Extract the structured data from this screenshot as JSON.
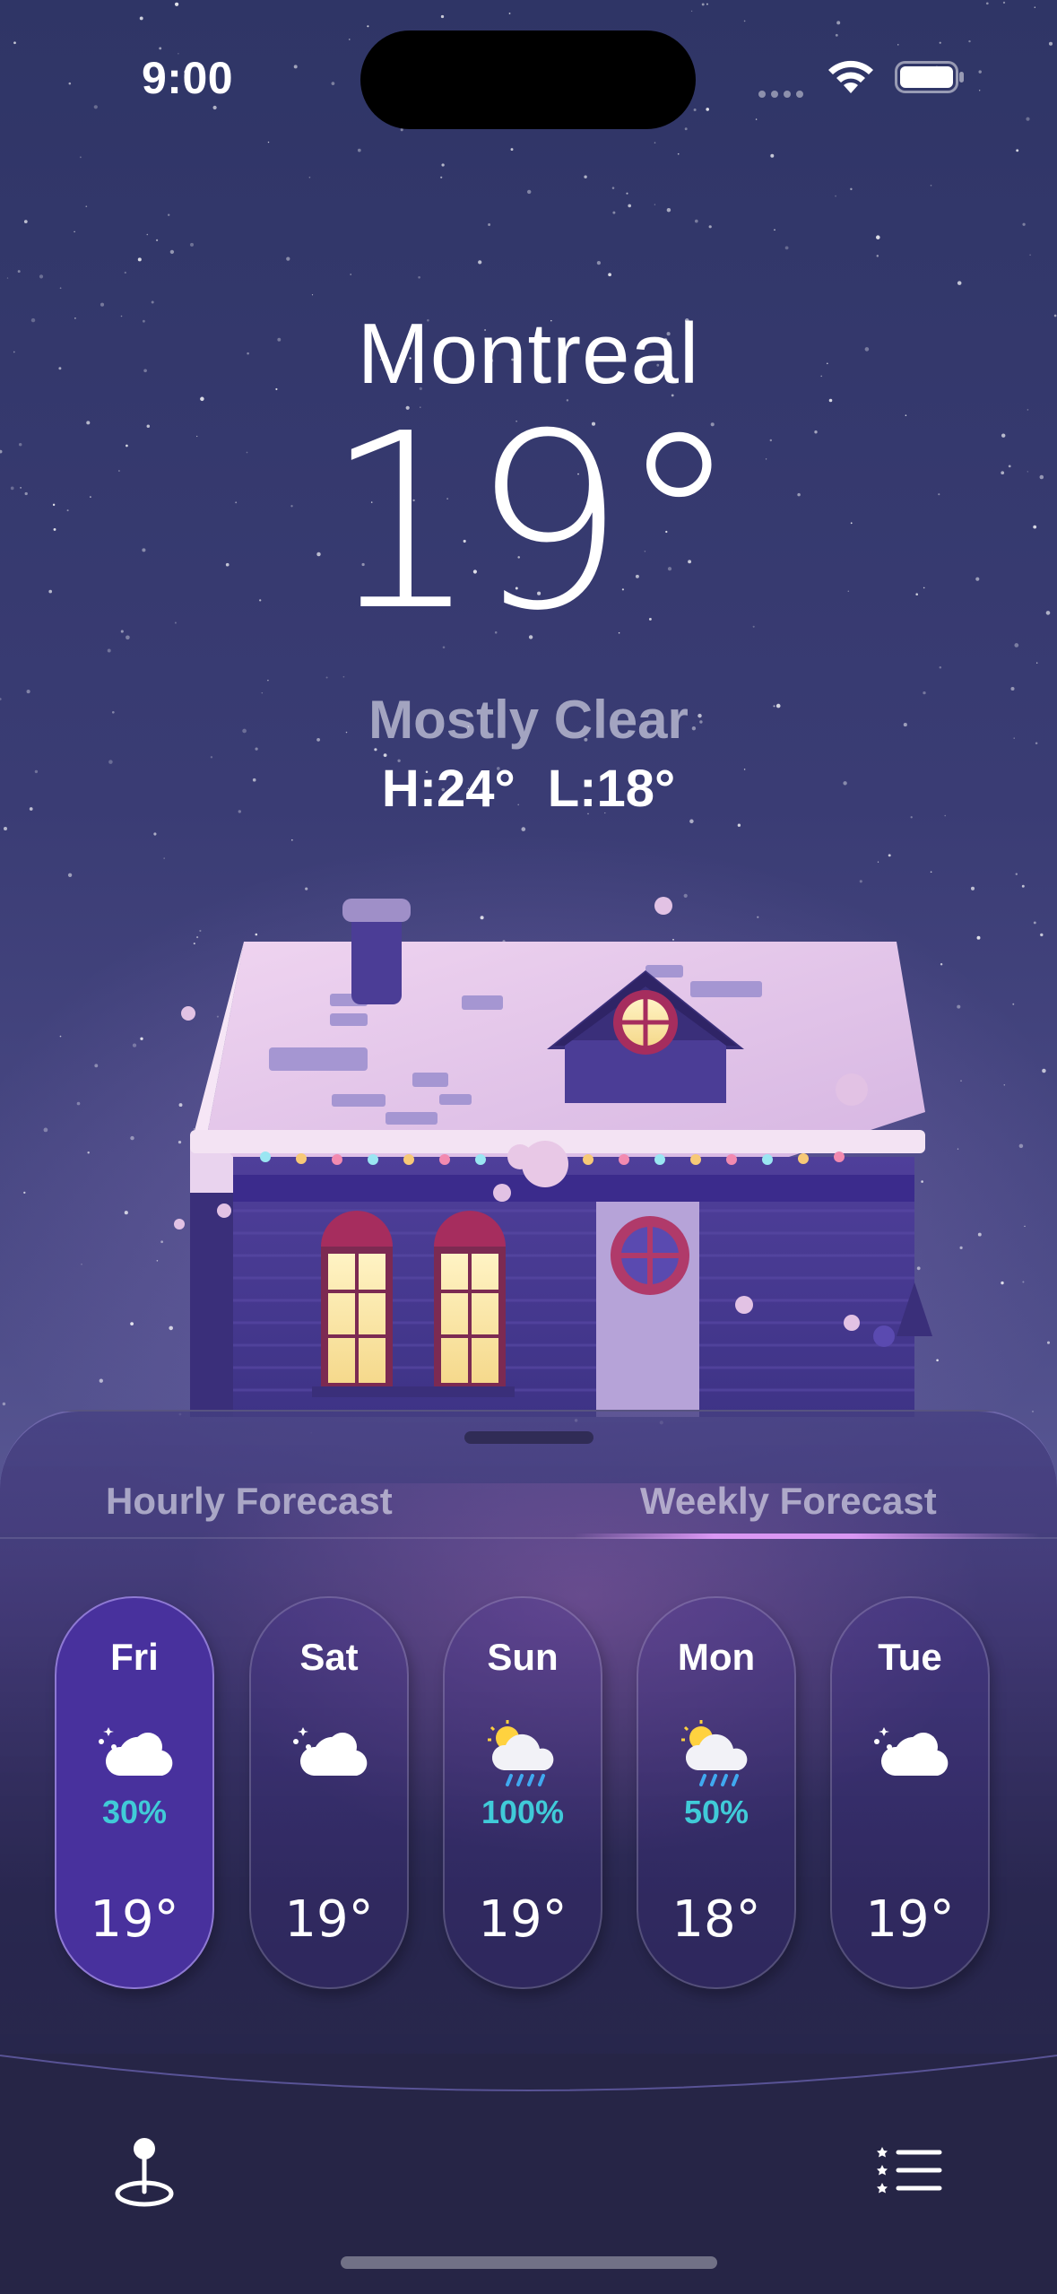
{
  "status_bar": {
    "time": "9:00"
  },
  "weather": {
    "city": "Montreal",
    "temperature": "19°",
    "condition": "Mostly Clear",
    "high": "H:24°",
    "low": "L:18°"
  },
  "sheet": {
    "tabs": [
      {
        "label": "Hourly Forecast",
        "selected": false
      },
      {
        "label": "Weekly Forecast",
        "selected": true
      }
    ],
    "days": [
      {
        "day": "Fri",
        "icon": "moon-cloud-icon",
        "precip": "30%",
        "temp": "19°",
        "selected": true
      },
      {
        "day": "Sat",
        "icon": "moon-cloud-icon",
        "precip": "",
        "temp": "19°",
        "selected": false
      },
      {
        "day": "Sun",
        "icon": "sun-cloud-rain-icon",
        "precip": "100%",
        "temp": "19°",
        "selected": false
      },
      {
        "day": "Mon",
        "icon": "sun-cloud-rain-icon",
        "precip": "50%",
        "temp": "18°",
        "selected": false
      },
      {
        "day": "Tue",
        "icon": "moon-cloud-icon",
        "precip": "",
        "temp": "19°",
        "selected": false
      }
    ]
  },
  "tab_bar": {
    "left_icon": "location-pin-icon",
    "right_icon": "list-icon"
  },
  "colors": {
    "accent_selected_pill": "#48319d",
    "precip_text": "#40cbd8",
    "sheet_background": "#262546"
  }
}
